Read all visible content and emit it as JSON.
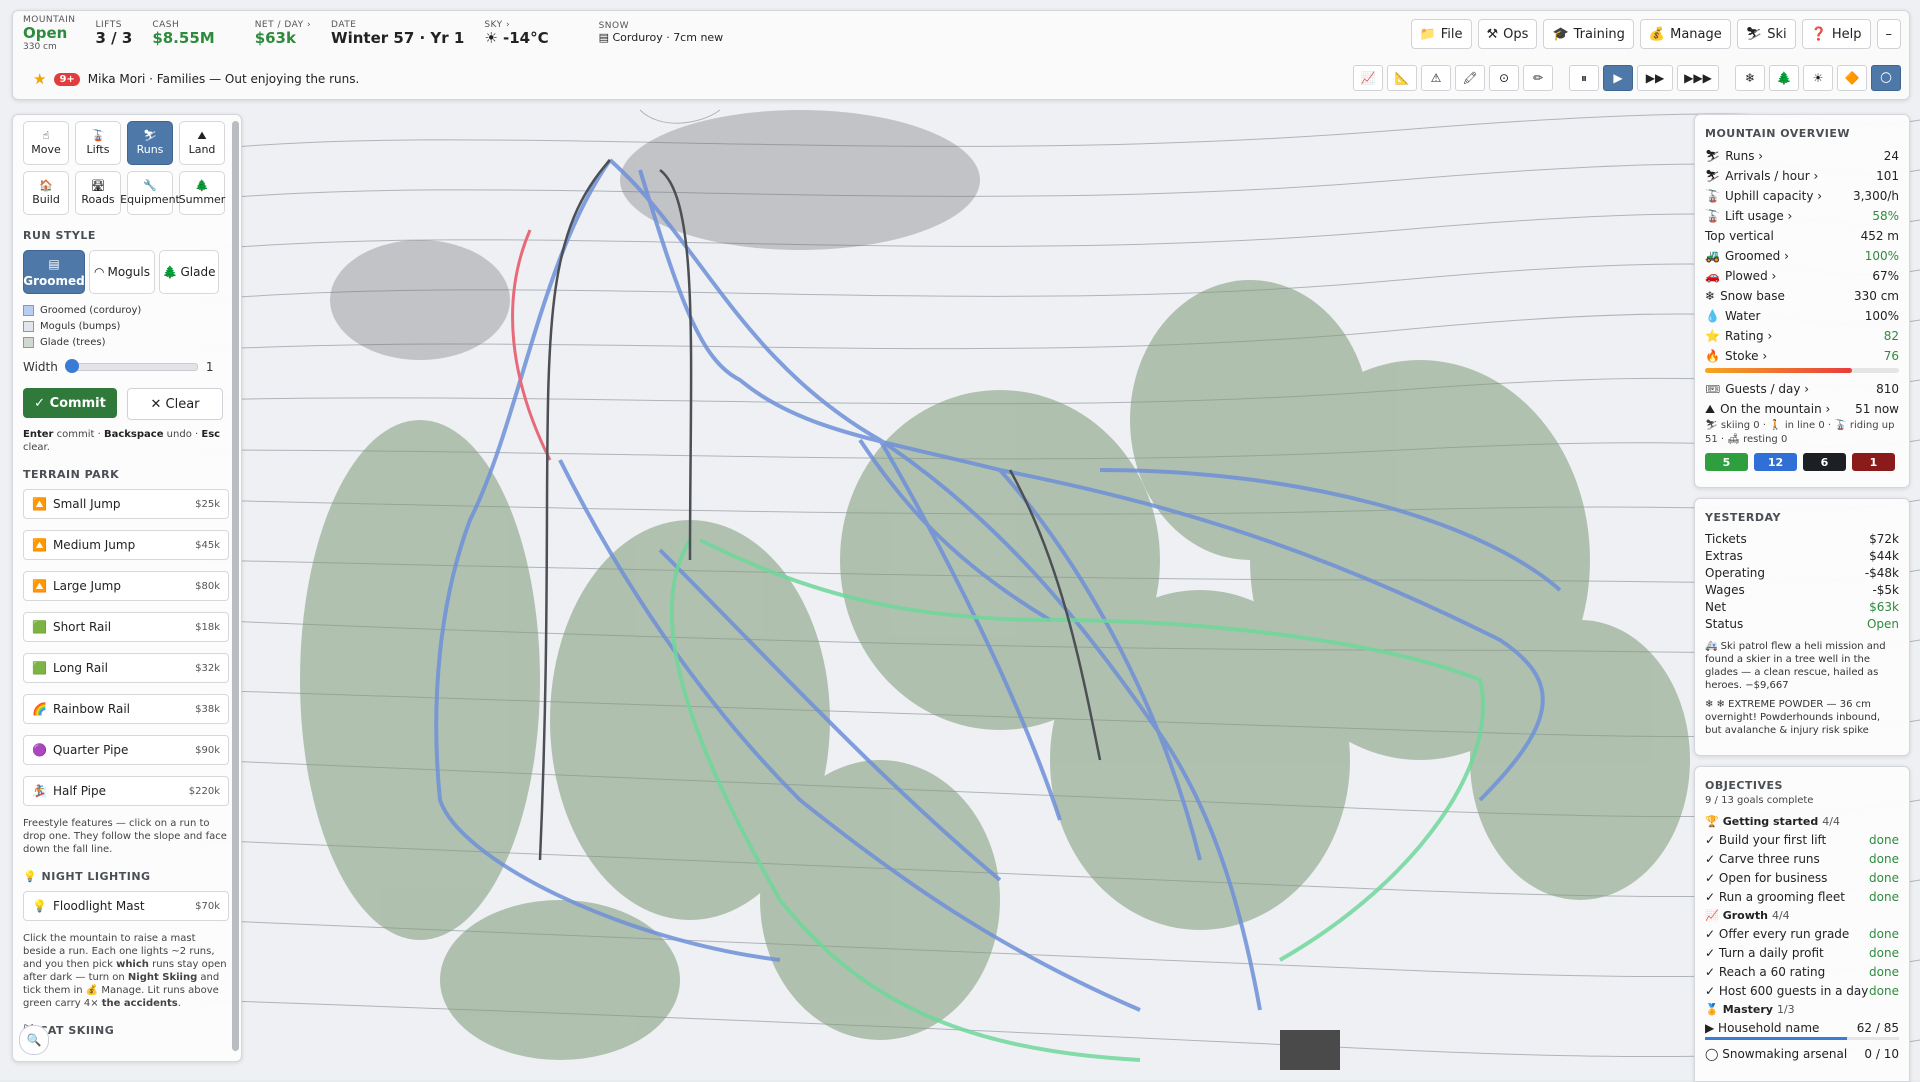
{
  "stats": [
    {
      "key": "MOUNTAIN",
      "value": "Open",
      "sub": "330 cm",
      "green": true
    },
    {
      "key": "LIFTS",
      "value": "3 / 3"
    },
    {
      "key": "CASH",
      "value": "$8.55M",
      "green": true
    },
    {
      "key": "NET / DAY ›",
      "value": "$63k",
      "green": true
    },
    {
      "key": "DATE",
      "value": "Winter 57 · Yr 1"
    },
    {
      "key": "SKY ›",
      "value": "☀ -14°C"
    },
    {
      "key": "SNOW",
      "value": "▤ Corduroy · 7cm new"
    }
  ],
  "menus": [
    {
      "icon": "📁",
      "label": "File"
    },
    {
      "icon": "⚒",
      "label": "Ops"
    },
    {
      "icon": "🎓",
      "label": "Training"
    },
    {
      "icon": "💰",
      "label": "Manage"
    },
    {
      "icon": "⛷",
      "label": "Ski"
    },
    {
      "icon": "❓",
      "label": "Help"
    },
    {
      "icon": "",
      "label": "–"
    }
  ],
  "ticker": {
    "badge": "9+",
    "text": "Mika Mori · Families — Out enjoying the runs."
  },
  "tools_left": [
    "📈",
    "📐",
    "⚠",
    "🖍",
    "⊙",
    "✏"
  ],
  "speed": [
    "⏸",
    "▶",
    "▶▶",
    "▶▶▶"
  ],
  "tools_right": [
    "❄",
    "🌲",
    "☀",
    "🔶",
    "🌕"
  ],
  "left": {
    "modes": [
      {
        "icon": "☝",
        "label": "Move"
      },
      {
        "icon": "🚡",
        "label": "Lifts"
      },
      {
        "icon": "⛷",
        "label": "Runs"
      },
      {
        "icon": "⛰",
        "label": "Land"
      },
      {
        "icon": "🏠",
        "label": "Build"
      },
      {
        "icon": "🛣",
        "label": "Roads"
      },
      {
        "icon": "🔧",
        "label": "Equipment"
      },
      {
        "icon": "🌲",
        "label": "Summer"
      }
    ],
    "run_style_title": "RUN STYLE",
    "styles": [
      {
        "icon": "▤",
        "label": "Groomed"
      },
      {
        "icon": "◠",
        "label": "Moguls"
      },
      {
        "icon": "🌲",
        "label": "Glade"
      }
    ],
    "legend": [
      "Groomed (corduroy)",
      "Moguls (bumps)",
      "Glade (trees)"
    ],
    "width_label": "Width",
    "width_value": "1",
    "commit": "✓ Commit",
    "clear": "✕ Clear",
    "hint_a": "Enter",
    "hint_b": " commit · ",
    "hint_c": "Backspace",
    "hint_d": " undo · ",
    "hint_e": "Esc",
    "hint_f": " clear.",
    "terrain_title": "TERRAIN PARK",
    "terrain": [
      {
        "icon": "🔼",
        "label": "Small Jump",
        "price": "$25k"
      },
      {
        "icon": "🔼",
        "label": "Medium Jump",
        "price": "$45k"
      },
      {
        "icon": "🔼",
        "label": "Large Jump",
        "price": "$80k"
      },
      {
        "icon": "🟩",
        "label": "Short Rail",
        "price": "$18k"
      },
      {
        "icon": "🟩",
        "label": "Long Rail",
        "price": "$32k"
      },
      {
        "icon": "🌈",
        "label": "Rainbow Rail",
        "price": "$38k"
      },
      {
        "icon": "🟣",
        "label": "Quarter Pipe",
        "price": "$90k"
      },
      {
        "icon": "🏂",
        "label": "Half Pipe",
        "price": "$220k"
      }
    ],
    "terrain_note": "Freestyle features — click on a run to drop one. They follow the slope and face down the fall line.",
    "night_title": "NIGHT LIGHTING",
    "night_item": {
      "icon": "💡",
      "label": "Floodlight Mast",
      "price": "$70k"
    },
    "night_note_a": "Click the mountain to raise a mast beside a run. Each one lights ~2 runs, and you then pick ",
    "night_note_b": "which",
    "night_note_c": " runs stay open after dark — turn on ",
    "night_note_d": "Night Skiing",
    "night_note_e": " and tick them in 💰 Manage. Lit runs above green carry 4× ",
    "night_note_f": "the accidents",
    "night_note_g": ".",
    "cat_title": "CAT SKIING"
  },
  "overview": {
    "title": "MOUNTAIN OVERVIEW",
    "rows": [
      {
        "icon": "⛷",
        "label": "Runs ›",
        "value": "24"
      },
      {
        "icon": "⛷",
        "label": "Arrivals / hour ›",
        "value": "101"
      },
      {
        "icon": "🚡",
        "label": "Uphill capacity ›",
        "value": "3,300/h"
      },
      {
        "icon": "🚡",
        "label": "Lift usage ›",
        "value": "58%",
        "color": "green"
      },
      {
        "icon": "",
        "label": "Top vertical",
        "value": "452 m"
      },
      {
        "icon": "🚜",
        "label": "Groomed ›",
        "value": "100%",
        "color": "green"
      },
      {
        "icon": "🚗",
        "label": "Plowed ›",
        "value": "67%"
      },
      {
        "icon": "❄",
        "label": "Snow base",
        "value": "330 cm"
      },
      {
        "icon": "💧",
        "label": "Water",
        "value": "100%"
      },
      {
        "icon": "⭐",
        "label": "Rating ›",
        "value": "82",
        "color": "green"
      },
      {
        "icon": "🔥",
        "label": "Stoke ›",
        "value": "76",
        "color": "green"
      }
    ],
    "stoke_fill": 0.76,
    "guests_label": "Guests / day ›",
    "guests_value": "810",
    "onmtn_label": "On the mountain ›",
    "onmtn_value": "51 now",
    "breakdown": "⛷ skiing 0 · 🚶 in line 0 · 🚡 riding up 51 · 🛋 resting 0",
    "counts": [
      {
        "value": "5",
        "color": "#2e9e3e"
      },
      {
        "value": "12",
        "color": "#2f6fd6"
      },
      {
        "value": "6",
        "color": "#1c1f24"
      },
      {
        "value": "1",
        "color": "#8b1a1a"
      }
    ]
  },
  "yesterday": {
    "title": "YESTERDAY",
    "rows": [
      {
        "label": "Tickets",
        "value": "$72k"
      },
      {
        "label": "Extras",
        "value": "$44k"
      },
      {
        "label": "Operating",
        "value": "-$48k"
      },
      {
        "label": "Wages",
        "value": "-$5k"
      },
      {
        "label": "Net",
        "value": "$63k",
        "color": "green"
      },
      {
        "label": "Status",
        "value": "Open",
        "color": "green"
      }
    ],
    "news": [
      "🚑 Ski patrol flew a heli mission and found a skier in a tree well in the glades — a clean rescue, hailed as heroes. −$9,667",
      "❄ ❄ EXTREME POWDER — 36 cm overnight! Powderhounds inbound, but avalanche & injury risk spike"
    ]
  },
  "objectives": {
    "title": "OBJECTIVES",
    "summary": "9 / 13 goals complete",
    "groups": [
      {
        "icon": "🏆",
        "name": "Getting started",
        "count": "4/4",
        "items": [
          {
            "label": "✓ Build your first lift",
            "status": "done"
          },
          {
            "label": "✓ Carve three runs",
            "status": "done"
          },
          {
            "label": "✓ Open for business",
            "status": "done"
          },
          {
            "label": "✓ Run a grooming fleet",
            "status": "done"
          }
        ]
      },
      {
        "icon": "📈",
        "name": "Growth",
        "count": "4/4",
        "items": [
          {
            "label": "✓ Offer every run grade",
            "status": "done"
          },
          {
            "label": "✓ Turn a daily profit",
            "status": "done"
          },
          {
            "label": "✓ Reach a 60 rating",
            "status": "done"
          },
          {
            "label": "✓ Host 600 guests in a day",
            "status": "done"
          }
        ]
      },
      {
        "icon": "🏅",
        "name": "Mastery",
        "count": "1/3",
        "items": [
          {
            "label": "▶ Household name",
            "status": "62 / 85",
            "progress": 0.73
          },
          {
            "label": "◯ Snowmaking arsenal",
            "status": "0 / 10",
            "progress": 0
          }
        ]
      }
    ]
  }
}
